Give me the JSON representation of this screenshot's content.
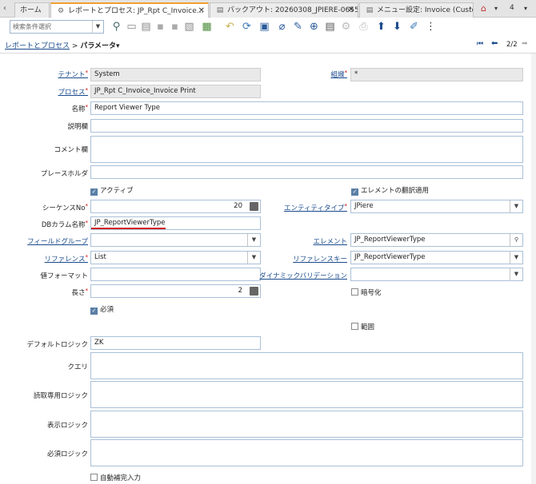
{
  "tabs": [
    {
      "label": "ホーム"
    },
    {
      "label": "レポートとプロセス: JP_Rpt C_Invoice..."
    },
    {
      "label": "バックアウト: 20260308_JPIERE-0655"
    },
    {
      "label": "メニュー設定: Invoice (Custo"
    }
  ],
  "tab_count": "4",
  "search": {
    "placeholder": "検索条件選択"
  },
  "breadcrumb": {
    "parent": "レポートとプロセス",
    "separator": ">",
    "current": "パラメータ▾"
  },
  "nav": {
    "record": "2/2"
  },
  "form": {
    "tenant": {
      "label": "テナント",
      "value": "System"
    },
    "org": {
      "label": "組織",
      "value": "*"
    },
    "process": {
      "label": "プロセス",
      "value": "JP_Rpt C_Invoice_Invoice Print"
    },
    "name": {
      "label": "名称",
      "value": "Report Viewer Type"
    },
    "description": {
      "label": "説明欄",
      "value": ""
    },
    "comment": {
      "label": "コメント欄",
      "value": ""
    },
    "placeholder": {
      "label": "プレースホルダ",
      "value": ""
    },
    "active": {
      "label": "アクティブ",
      "checked": true
    },
    "element_translation": {
      "label": "エレメントの翻訳適用",
      "checked": true
    },
    "seq": {
      "label": "シーケンスNo",
      "value": "20"
    },
    "entity_type": {
      "label": "エンティティタイプ",
      "value": "JPiere"
    },
    "db_column": {
      "label": "DBカラム名称",
      "value": "JP_ReportViewerType"
    },
    "field_group": {
      "label": "フィールドグループ",
      "value": ""
    },
    "element": {
      "label": "エレメント",
      "value": "JP_ReportViewerType"
    },
    "reference": {
      "label": "リファレンス",
      "value": "List"
    },
    "reference_key": {
      "label": "リファレンスキー",
      "value": "JP_ReportViewerType"
    },
    "value_format": {
      "label": "値フォーマット",
      "value": ""
    },
    "dynamic_validation": {
      "label": "ダイナミックバリデーション",
      "value": ""
    },
    "length": {
      "label": "長さ",
      "value": "2"
    },
    "encrypted": {
      "label": "暗号化",
      "checked": false
    },
    "mandatory": {
      "label": "必須",
      "checked": true
    },
    "range": {
      "label": "範囲",
      "checked": false
    },
    "default_logic": {
      "label": "デフォルトロジック",
      "value": "ZK"
    },
    "query": {
      "label": "クエリ",
      "value": ""
    },
    "readonly_logic": {
      "label": "読取専用ロジック",
      "value": ""
    },
    "display_logic": {
      "label": "表示ロジック",
      "value": ""
    },
    "mandatory_logic": {
      "label": "必須ロジック",
      "value": ""
    },
    "autocomplete": {
      "label": "自動補完入力",
      "checked": false
    }
  }
}
